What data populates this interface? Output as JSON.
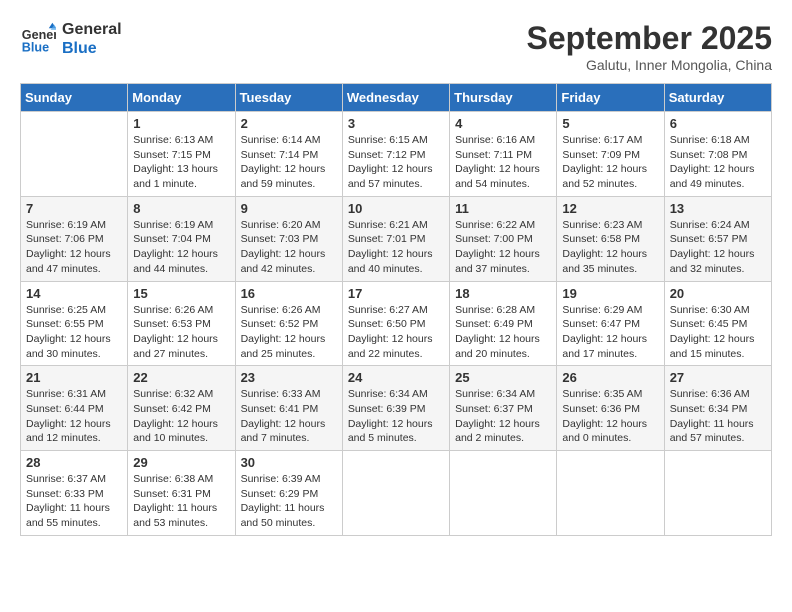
{
  "logo": {
    "line1": "General",
    "line2": "Blue"
  },
  "title": "September 2025",
  "location": "Galutu, Inner Mongolia, China",
  "days_of_week": [
    "Sunday",
    "Monday",
    "Tuesday",
    "Wednesday",
    "Thursday",
    "Friday",
    "Saturday"
  ],
  "weeks": [
    [
      {
        "num": "",
        "info": ""
      },
      {
        "num": "1",
        "info": "Sunrise: 6:13 AM\nSunset: 7:15 PM\nDaylight: 13 hours\nand 1 minute."
      },
      {
        "num": "2",
        "info": "Sunrise: 6:14 AM\nSunset: 7:14 PM\nDaylight: 12 hours\nand 59 minutes."
      },
      {
        "num": "3",
        "info": "Sunrise: 6:15 AM\nSunset: 7:12 PM\nDaylight: 12 hours\nand 57 minutes."
      },
      {
        "num": "4",
        "info": "Sunrise: 6:16 AM\nSunset: 7:11 PM\nDaylight: 12 hours\nand 54 minutes."
      },
      {
        "num": "5",
        "info": "Sunrise: 6:17 AM\nSunset: 7:09 PM\nDaylight: 12 hours\nand 52 minutes."
      },
      {
        "num": "6",
        "info": "Sunrise: 6:18 AM\nSunset: 7:08 PM\nDaylight: 12 hours\nand 49 minutes."
      }
    ],
    [
      {
        "num": "7",
        "info": "Sunrise: 6:19 AM\nSunset: 7:06 PM\nDaylight: 12 hours\nand 47 minutes."
      },
      {
        "num": "8",
        "info": "Sunrise: 6:19 AM\nSunset: 7:04 PM\nDaylight: 12 hours\nand 44 minutes."
      },
      {
        "num": "9",
        "info": "Sunrise: 6:20 AM\nSunset: 7:03 PM\nDaylight: 12 hours\nand 42 minutes."
      },
      {
        "num": "10",
        "info": "Sunrise: 6:21 AM\nSunset: 7:01 PM\nDaylight: 12 hours\nand 40 minutes."
      },
      {
        "num": "11",
        "info": "Sunrise: 6:22 AM\nSunset: 7:00 PM\nDaylight: 12 hours\nand 37 minutes."
      },
      {
        "num": "12",
        "info": "Sunrise: 6:23 AM\nSunset: 6:58 PM\nDaylight: 12 hours\nand 35 minutes."
      },
      {
        "num": "13",
        "info": "Sunrise: 6:24 AM\nSunset: 6:57 PM\nDaylight: 12 hours\nand 32 minutes."
      }
    ],
    [
      {
        "num": "14",
        "info": "Sunrise: 6:25 AM\nSunset: 6:55 PM\nDaylight: 12 hours\nand 30 minutes."
      },
      {
        "num": "15",
        "info": "Sunrise: 6:26 AM\nSunset: 6:53 PM\nDaylight: 12 hours\nand 27 minutes."
      },
      {
        "num": "16",
        "info": "Sunrise: 6:26 AM\nSunset: 6:52 PM\nDaylight: 12 hours\nand 25 minutes."
      },
      {
        "num": "17",
        "info": "Sunrise: 6:27 AM\nSunset: 6:50 PM\nDaylight: 12 hours\nand 22 minutes."
      },
      {
        "num": "18",
        "info": "Sunrise: 6:28 AM\nSunset: 6:49 PM\nDaylight: 12 hours\nand 20 minutes."
      },
      {
        "num": "19",
        "info": "Sunrise: 6:29 AM\nSunset: 6:47 PM\nDaylight: 12 hours\nand 17 minutes."
      },
      {
        "num": "20",
        "info": "Sunrise: 6:30 AM\nSunset: 6:45 PM\nDaylight: 12 hours\nand 15 minutes."
      }
    ],
    [
      {
        "num": "21",
        "info": "Sunrise: 6:31 AM\nSunset: 6:44 PM\nDaylight: 12 hours\nand 12 minutes."
      },
      {
        "num": "22",
        "info": "Sunrise: 6:32 AM\nSunset: 6:42 PM\nDaylight: 12 hours\nand 10 minutes."
      },
      {
        "num": "23",
        "info": "Sunrise: 6:33 AM\nSunset: 6:41 PM\nDaylight: 12 hours\nand 7 minutes."
      },
      {
        "num": "24",
        "info": "Sunrise: 6:34 AM\nSunset: 6:39 PM\nDaylight: 12 hours\nand 5 minutes."
      },
      {
        "num": "25",
        "info": "Sunrise: 6:34 AM\nSunset: 6:37 PM\nDaylight: 12 hours\nand 2 minutes."
      },
      {
        "num": "26",
        "info": "Sunrise: 6:35 AM\nSunset: 6:36 PM\nDaylight: 12 hours\nand 0 minutes."
      },
      {
        "num": "27",
        "info": "Sunrise: 6:36 AM\nSunset: 6:34 PM\nDaylight: 11 hours\nand 57 minutes."
      }
    ],
    [
      {
        "num": "28",
        "info": "Sunrise: 6:37 AM\nSunset: 6:33 PM\nDaylight: 11 hours\nand 55 minutes."
      },
      {
        "num": "29",
        "info": "Sunrise: 6:38 AM\nSunset: 6:31 PM\nDaylight: 11 hours\nand 53 minutes."
      },
      {
        "num": "30",
        "info": "Sunrise: 6:39 AM\nSunset: 6:29 PM\nDaylight: 11 hours\nand 50 minutes."
      },
      {
        "num": "",
        "info": ""
      },
      {
        "num": "",
        "info": ""
      },
      {
        "num": "",
        "info": ""
      },
      {
        "num": "",
        "info": ""
      }
    ]
  ]
}
